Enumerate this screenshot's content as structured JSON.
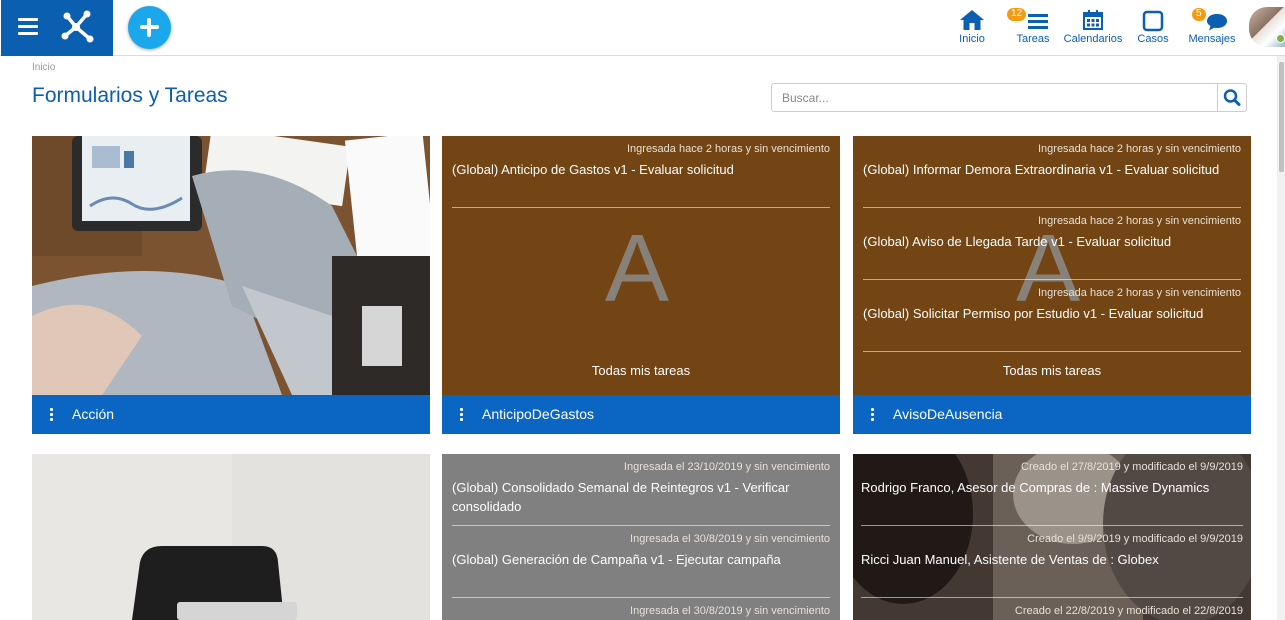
{
  "header": {
    "nav": [
      {
        "label": "Inicio",
        "icon": "home-icon"
      },
      {
        "label": "Tareas",
        "icon": "tasks-icon",
        "badge": "12"
      },
      {
        "label": "Calendarios",
        "icon": "calendar-icon"
      },
      {
        "label": "Casos",
        "icon": "cases-icon"
      },
      {
        "label": "Mensajes",
        "icon": "messages-icon",
        "badge": "5"
      }
    ]
  },
  "breadcrumb": "Inicio",
  "page_title": "Formularios y Tareas",
  "search": {
    "placeholder": "Buscar..."
  },
  "colors": {
    "brand": "#0b5fb0",
    "card_footer": "#0b66c3",
    "brown_card": "#734514",
    "gray_card": "#808080",
    "badge": "#f39c12",
    "add_button": "#1aa7ec"
  },
  "cards": [
    {
      "footer": "Acción"
    },
    {
      "footer": "AnticipoDeGastos",
      "letter": "A",
      "tasks": [
        {
          "meta": "Ingresada hace 2 horas y sin vencimiento",
          "name": "(Global) Anticipo de Gastos v1 - Evaluar solicitud"
        }
      ],
      "all_tasks": "Todas mis tareas"
    },
    {
      "footer": "AvisoDeAusencia",
      "letter": "A",
      "tasks": [
        {
          "meta": "Ingresada hace 2 horas y sin vencimiento",
          "name": "(Global) Informar Demora Extraordinaria v1 - Evaluar solicitud"
        },
        {
          "meta": "Ingresada hace 2 horas y sin vencimiento",
          "name": "(Global) Aviso de Llegada Tarde v1 - Evaluar solicitud"
        },
        {
          "meta": "Ingresada hace 2 horas y sin vencimiento",
          "name": "(Global) Solicitar Permiso por Estudio v1 - Evaluar solicitud"
        }
      ],
      "all_tasks": "Todas mis tareas"
    },
    {
      "footer": ""
    },
    {
      "tasks": [
        {
          "meta": "Ingresada el 23/10/2019 y sin vencimiento",
          "name": "(Global) Consolidado Semanal de Reintegros v1 - Verificar consolidado"
        },
        {
          "meta": "Ingresada el 30/8/2019 y sin vencimiento",
          "name": "(Global) Generación de Campaña v1 - Ejecutar campaña"
        },
        {
          "meta": "Ingresada el 30/8/2019 y sin vencimiento",
          "name": ""
        }
      ]
    },
    {
      "tasks": [
        {
          "meta": "Creado el 27/8/2019 y modificado el 9/9/2019",
          "name": "Rodrigo Franco, Asesor de Compras de : Massive Dynamics"
        },
        {
          "meta": "Creado el 9/9/2019 y modificado el 9/9/2019",
          "name": "Ricci Juan Manuel, Asistente de Ventas de : Globex"
        },
        {
          "meta": "Creado el 22/8/2019 y modificado el 22/8/2019",
          "name": ""
        }
      ]
    }
  ]
}
